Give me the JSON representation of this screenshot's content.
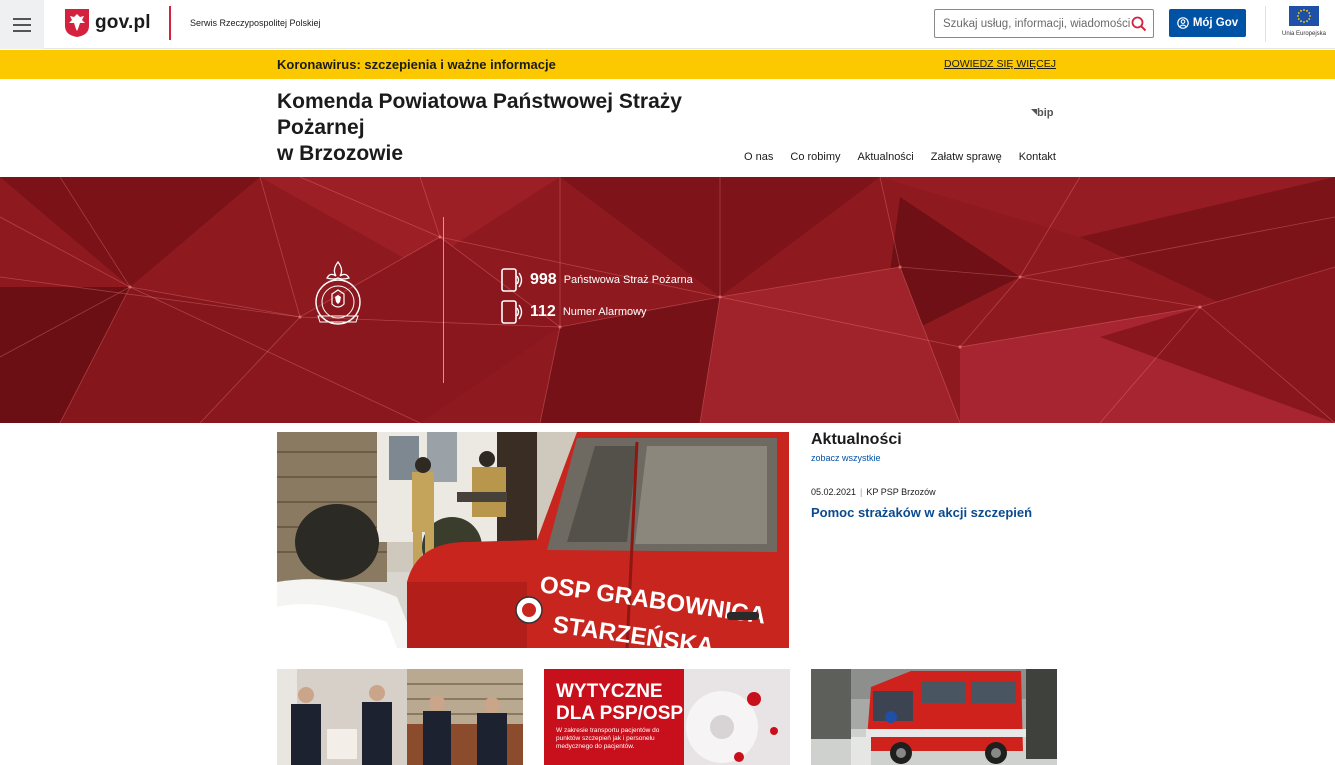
{
  "topbar": {
    "logo_text": "gov.pl",
    "service_name": "Serwis Rzeczypospolitej Polskiej",
    "search_placeholder": "Szukaj usług, informacji, wiadomości",
    "moj_gov_label": "Mój Gov",
    "eu_label": "Unia Europejska",
    "icons": [
      "menu-icon",
      "eagle-icon",
      "search-icon",
      "user-circle-icon",
      "eu-flag-icon"
    ]
  },
  "banner": {
    "text": "Koronawirus: szczepienia i ważne informacje",
    "link": "DOWIEDZ SIĘ WIĘCEJ",
    "color": "#fcc900"
  },
  "institution": {
    "name_line1": "Komenda Powiatowa Państwowej Straży",
    "name_line2": "Pożarnej",
    "name_line3": "w Brzozowie",
    "bip": "bip"
  },
  "nav": {
    "items": [
      "O nas",
      "Co robimy",
      "Aktualności",
      "Załatw sprawę",
      "Kontakt"
    ]
  },
  "hero": {
    "color": "#8a141c",
    "phones": [
      {
        "number": "998",
        "label": "Państwowa Straż Pożarna"
      },
      {
        "number": "112",
        "label": "Numer Alarmowy"
      }
    ]
  },
  "news": {
    "title": "Aktualności",
    "see_all": "zobacz wszystkie",
    "date": "05.02.2021",
    "source": "KP PSP Brzozów",
    "headline": "Pomoc strażaków w akcji szczepień",
    "photo_text_line1": "OSP GRABOWNICA",
    "photo_text_line2": "STARZEŃSKA"
  },
  "thumbs": {
    "middle_line1": "WYTYCZNE",
    "middle_line2": "DLA PSP/OSP",
    "middle_small": "W zakresie transportu pacjentów do punktów szczepień jak i personelu medycznego do pacjentów."
  },
  "colors": {
    "accent": "#0052a5",
    "brand_red": "#d4213d",
    "headline_blue": "#0b4a8f"
  }
}
